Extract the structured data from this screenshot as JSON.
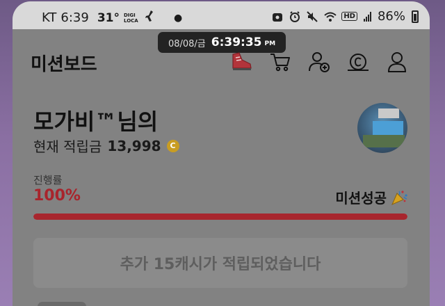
{
  "status_bar": {
    "carrier": "KT",
    "time": "6:39",
    "temperature": "31°",
    "digi_line1": "DIGI",
    "digi_line2": "LOCA",
    "battery_percent": "86%"
  },
  "overlay_clock": {
    "date": "08/08/금",
    "time": "6:39:35",
    "ampm": "PM"
  },
  "header": {
    "title": "미션보드",
    "icons": [
      "shoe-icon",
      "cart-icon",
      "add-user-icon",
      "coin-shop-icon",
      "profile-icon"
    ]
  },
  "user": {
    "name": "모가비™님의",
    "points_label": "현재 적립금",
    "points_value": "13,998",
    "coin_symbol": "C"
  },
  "progress": {
    "label": "진행률",
    "value_text": "100%",
    "fraction": 1.0,
    "status_text": "미션성공"
  },
  "reward": {
    "message": "추가 15캐시가 적립되었습니다"
  },
  "colors": {
    "accent_red": "#a8242c",
    "coin_gold": "#c99d22"
  }
}
